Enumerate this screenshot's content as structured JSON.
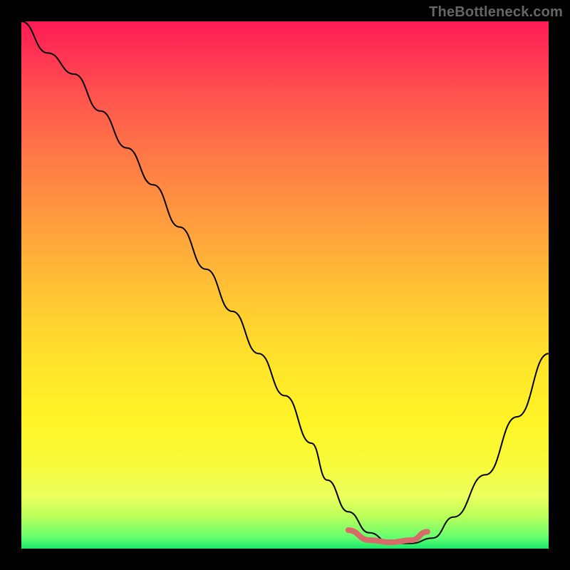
{
  "watermark": "TheBottleneck.com",
  "chart_data": {
    "type": "line",
    "title": "",
    "xlabel": "",
    "ylabel": "",
    "xlim": [
      0,
      100
    ],
    "ylim": [
      0,
      100
    ],
    "series": [
      {
        "name": "bottleneck-curve",
        "x": [
          0,
          5,
          10,
          15,
          20,
          25,
          30,
          35,
          40,
          45,
          50,
          55,
          58,
          62,
          66,
          70,
          74,
          78,
          82,
          88,
          94,
          100
        ],
        "y": [
          100,
          94,
          90,
          83,
          76,
          69,
          61,
          53,
          45,
          37,
          29,
          20,
          13,
          7,
          3,
          1,
          1,
          2,
          6,
          14,
          25,
          37
        ]
      }
    ],
    "highlight": {
      "name": "optimal-range",
      "x": [
        62,
        66,
        70,
        74,
        77
      ],
      "y": [
        3.5,
        1.6,
        1.2,
        1.6,
        3.2
      ]
    },
    "background_gradient": {
      "top": "#ff1a55",
      "mid1": "#ff963f",
      "mid2": "#ffe62a",
      "bottom": "#18e86a"
    }
  }
}
